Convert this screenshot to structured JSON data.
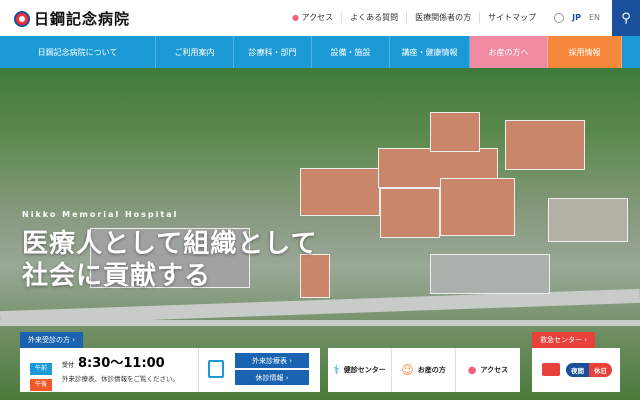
{
  "header": {
    "logo": "日鋼記念病院",
    "util": [
      "アクセス",
      "よくある質問",
      "医療関係者の方",
      "サイトマップ"
    ],
    "lang": [
      "JP",
      "EN"
    ]
  },
  "nav": [
    "日鋼記念病院について",
    "ご利用案内",
    "診療科・部門",
    "設備・施設",
    "講座・健康情報",
    "お産の方へ",
    "採用情報"
  ],
  "hero": {
    "subtitle": "Nikko Memorial Hospital",
    "title1": "医療人として組織として",
    "title2": "社会に貢献する"
  },
  "outpatient": {
    "tab": "外来受診の方 ›",
    "am": "午前",
    "pm": "午後",
    "reception_label": "受付",
    "hours": "8:30〜11:00",
    "note": "外来診療表、休診情報をご覧ください。",
    "btn1": "外来診療表 ›",
    "btn2": "休診情報 ›"
  },
  "links": [
    "健診センター",
    "お産の方",
    "アクセス"
  ],
  "emergency": {
    "tab": "救急センター ›",
    "night": "夜間",
    "holiday": "休日"
  },
  "colors": {
    "nav": "#1b9ad6",
    "navy": "#1a4f9c",
    "pink": "#f08aa0",
    "orange": "#f5883a",
    "red": "#e8413a"
  }
}
